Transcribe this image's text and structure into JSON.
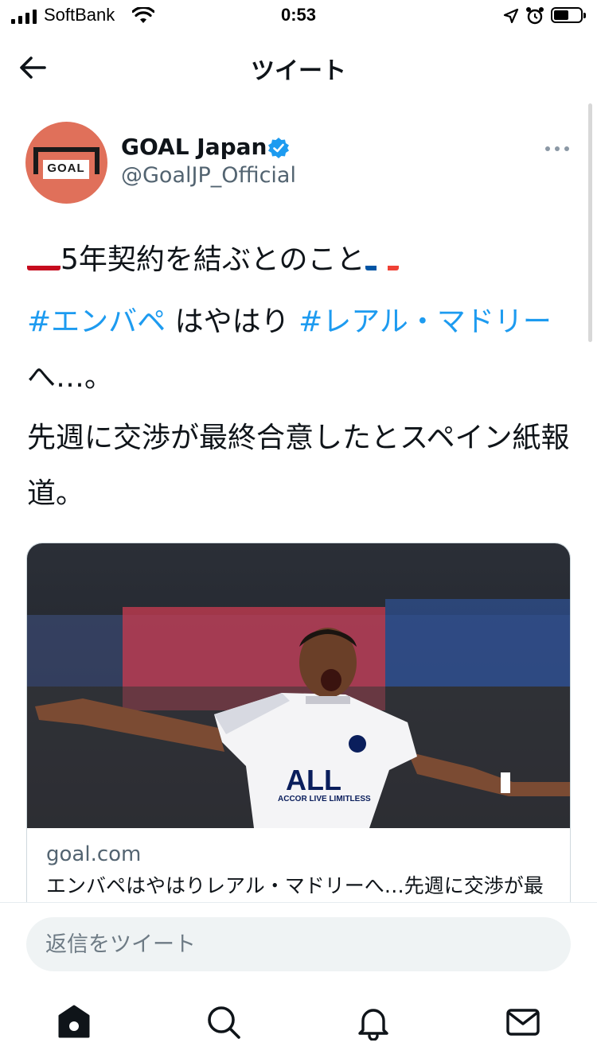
{
  "status_bar": {
    "carrier": "SoftBank",
    "time": "0:53",
    "battery_level": 0.45
  },
  "header": {
    "title": "ツイート",
    "back_icon": "arrow-left-icon"
  },
  "tweet": {
    "author": {
      "name": "GOAL Japan",
      "handle": "@GoalJP_Official",
      "verified": true,
      "avatar_text": "GOAL",
      "avatar_color": "#e0705a"
    },
    "line1": {
      "flag_left": "spain-flag",
      "text": "5年契約を結ぶとのこと",
      "flag_right": "france-flag"
    },
    "line2": {
      "hashtag1": "#エンバペ",
      "middle": " はやはり ",
      "hashtag2": "#レアル・マドリー",
      "tail": " へ…。"
    },
    "line3": "先週に交渉が最終合意したとスペイン紙報道。",
    "card": {
      "domain": "goal.com",
      "description": "エンバペはやはりレアル・マドリーへ…先週に交渉が最終合意したとスペイン紙報道",
      "image_desc": "player-celebration-photo"
    }
  },
  "reply": {
    "placeholder": "返信をツイート"
  },
  "tab_bar": {
    "items": [
      "home-icon",
      "search-icon",
      "notifications-icon",
      "messages-icon"
    ]
  },
  "colors": {
    "accent": "#1d9bf0",
    "text": "#0f1419",
    "secondary": "#536471"
  }
}
